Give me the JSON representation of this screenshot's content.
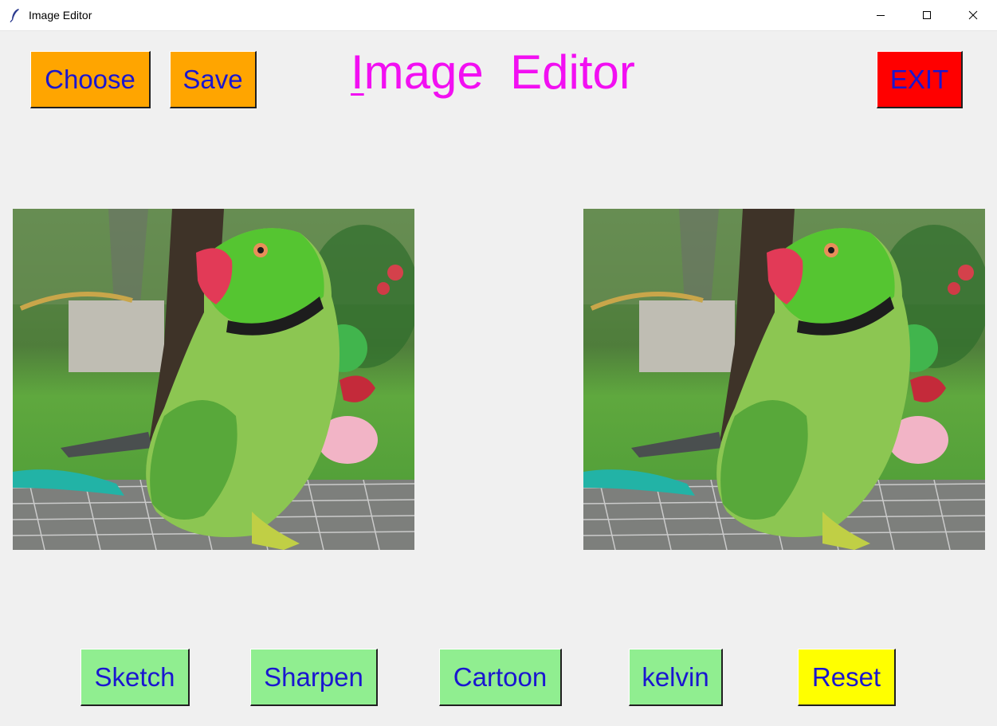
{
  "window": {
    "title": "Image Editor"
  },
  "toolbar": {
    "choose_label": "Choose",
    "save_label": "Save",
    "exit_label": "EXIT"
  },
  "heading": {
    "first_letter": "I",
    "rest": "mage  Editor"
  },
  "images": {
    "original": {
      "subject": "green parakeet"
    },
    "edited": {
      "subject": "green parakeet"
    }
  },
  "filters": {
    "sketch_label": "Sketch",
    "sharpen_label": "Sharpen",
    "cartoon_label": "Cartoon",
    "kelvin_label": "kelvin",
    "reset_label": "Reset"
  },
  "colors": {
    "background": "#f0f0f0",
    "orange_button": "#ffa500",
    "exit_button": "#ff0000",
    "filter_button": "#90ee90",
    "reset_button": "#ffff00",
    "button_text": "#1a16d0",
    "heading": "#f20ff2"
  }
}
